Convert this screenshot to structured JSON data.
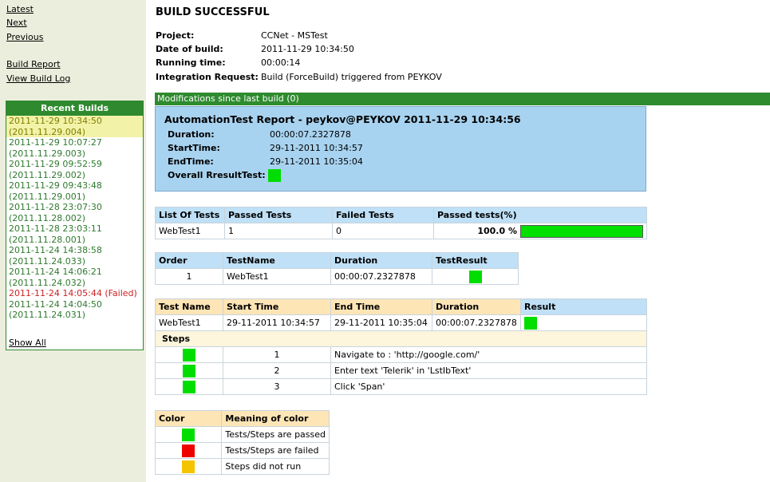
{
  "nav": {
    "latest": "Latest",
    "next": "Next",
    "previous": "Previous",
    "build_report": "Build Report",
    "view_build_log": "View Build Log"
  },
  "recent_builds": {
    "title": "Recent Builds",
    "items": [
      {
        "date": "2011-11-29 10:34:50",
        "label": "(2011.11.29.004)",
        "state": "current"
      },
      {
        "date": "2011-11-29 10:07:27",
        "label": "(2011.11.29.003)",
        "state": "ok"
      },
      {
        "date": "2011-11-29 09:52:59",
        "label": "(2011.11.29.002)",
        "state": "ok"
      },
      {
        "date": "2011-11-29 09:43:48",
        "label": "(2011.11.29.001)",
        "state": "ok"
      },
      {
        "date": "2011-11-28 23:07:30",
        "label": "(2011.11.28.002)",
        "state": "ok"
      },
      {
        "date": "2011-11-28 23:03:11",
        "label": "(2011.11.28.001)",
        "state": "ok"
      },
      {
        "date": "2011-11-24 14:38:58",
        "label": "(2011.11.24.033)",
        "state": "ok"
      },
      {
        "date": "2011-11-24 14:06:21",
        "label": "(2011.11.24.032)",
        "state": "ok"
      },
      {
        "date": "2011-11-24 14:05:44 (Failed)",
        "label": "",
        "state": "failed"
      },
      {
        "date": "2011-11-24 14:04:50",
        "label": "(2011.11.24.031)",
        "state": "ok"
      }
    ],
    "show_all": "Show All"
  },
  "header": {
    "title": "BUILD SUCCESSFUL",
    "project_label": "Project:",
    "project": "CCNet - MSTest",
    "date_label": "Date of build:",
    "date": "2011-11-29 10:34:50",
    "running_label": "Running time:",
    "running": "00:00:14",
    "request_label": "Integration Request:",
    "request": "Build (ForceBuild) triggered from PEYKOV"
  },
  "modifications": "Modifications since last build (0)",
  "report": {
    "title": "AutomationTest Report - peykov@PEYKOV 2011-11-29 10:34:56",
    "duration_label": "Duration:",
    "duration": "00:00:07.2327878",
    "start_label": "StartTime:",
    "start": "29-11-2011 10:34:57",
    "end_label": "EndTime:",
    "end": "29-11-2011 10:35:04",
    "overall_label": "Overall RresultTest:"
  },
  "summary": {
    "headers": [
      "List Of Tests",
      "Passed Tests",
      "Failed Tests",
      "Passed tests(%)"
    ],
    "row": {
      "name": "WebTest1",
      "passed": "1",
      "failed": "0",
      "percent": "100.0 %",
      "percent_value": 100
    }
  },
  "order_table": {
    "headers": [
      "Order",
      "TestName",
      "Duration",
      "TestResult"
    ],
    "row": {
      "order": "1",
      "name": "WebTest1",
      "duration": "00:00:07.2327878"
    }
  },
  "detail_table": {
    "headers": [
      "Test Name",
      "Start Time",
      "End Time",
      "Duration",
      "Result"
    ],
    "row": {
      "name": "WebTest1",
      "start": "29-11-2011 10:34:57",
      "end": "29-11-2011 10:35:04",
      "duration": "00:00:07.2327878"
    },
    "steps_label": "Steps",
    "steps": [
      {
        "num": "1",
        "text": "Navigate to : 'http://google.com/'"
      },
      {
        "num": "2",
        "text": "Enter text 'Telerik' in 'LstIbText'"
      },
      {
        "num": "3",
        "text": "Click 'Span'"
      }
    ]
  },
  "legend": {
    "headers": [
      "Color",
      "Meaning of color"
    ],
    "rows": [
      {
        "color": "#00dd00",
        "text": "Tests/Steps are passed"
      },
      {
        "color": "#ee0000",
        "text": "Tests/Steps are failed"
      },
      {
        "color": "#f5c400",
        "text": "Steps did not run"
      }
    ]
  }
}
